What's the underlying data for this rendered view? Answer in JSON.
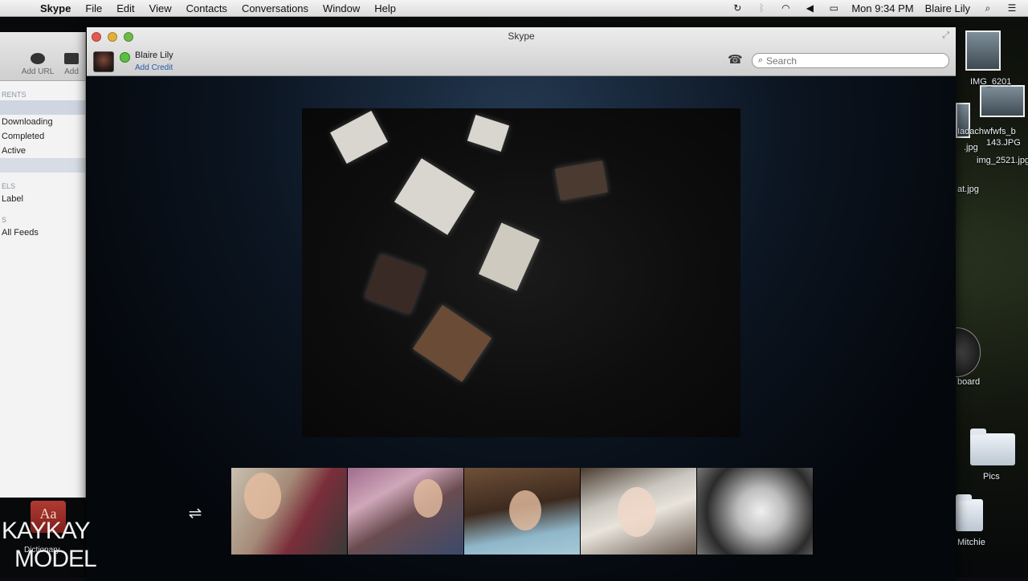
{
  "menubar": {
    "app": "Skype",
    "menus": [
      "File",
      "Edit",
      "View",
      "Contacts",
      "Conversations",
      "Window",
      "Help"
    ],
    "clock": "Mon 9:34 PM",
    "user": "Blaire Lily",
    "status_icons": [
      "time-machine-icon",
      "bluetooth-icon",
      "wifi-icon",
      "volume-icon",
      "battery-icon",
      "spotlight-icon",
      "list-icon"
    ]
  },
  "bg_window": {
    "toolbar": [
      "Add URL",
      "Add"
    ],
    "section_torrents": "RENTS",
    "items": [
      "Downloading",
      "Completed",
      "Active"
    ],
    "section_labels": "ELS",
    "label_item": "Label",
    "section_feeds": "S",
    "feeds_item": "All Feeds"
  },
  "skype": {
    "window_title": "Skype",
    "profile_name": "Blaire Lily",
    "add_credit": "Add Credit",
    "search_placeholder": "Search",
    "status": "online",
    "participants": 5
  },
  "desktop": {
    "files": [
      "IMG_6201",
      "Iadachwfwfs_b",
      "143.JPG",
      "img_2521.jpg",
      ".jpg",
      "at.jpg"
    ],
    "dashboard": "board",
    "folders": [
      "Pics",
      "Mitchie"
    ]
  },
  "dock": {
    "dictionary": "Dictionary"
  },
  "watermark": {
    "line1": "KAYKAY",
    "line2": "MODEL"
  },
  "colors": {
    "accent_link": "#2a5aa8",
    "status_online": "#5cbf3f"
  }
}
